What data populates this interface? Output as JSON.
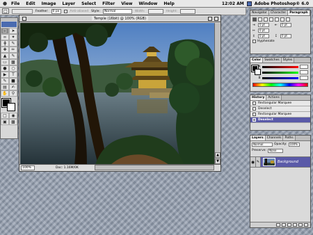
{
  "menubar": {
    "items": [
      "File",
      "Edit",
      "Image",
      "Layer",
      "Select",
      "Filter",
      "View",
      "Window",
      "Help"
    ],
    "clock": "12:02 AM",
    "app_name": "Adobe Photoshop® 6.0"
  },
  "options_bar": {
    "feather_label": "Feather:",
    "feather_value": "0 px",
    "antialiased_label": "Anti-aliased",
    "style_label": "Style:",
    "style_value": "Normal",
    "width_label": "Width:",
    "height_label": "Height:"
  },
  "document": {
    "title": "Temple (16bit) @ 100% (RGB)",
    "zoom": "100%",
    "doc_size": "Doc: 1.16M/0K"
  },
  "paragraph_palette": {
    "tabs": [
      "Navigator",
      "Character",
      "Paragraph"
    ],
    "fields": [
      "0 pt",
      "0 pt",
      "0 pt",
      "0 pt",
      "0 pt"
    ],
    "hyphenate_label": "Hyphenate"
  },
  "color_palette": {
    "tabs": [
      "Color",
      "Swatches",
      "Styles"
    ],
    "channels": [
      "R",
      "G",
      "B"
    ]
  },
  "history_palette": {
    "tabs": [
      "History",
      "Actions"
    ],
    "items": [
      "Rectangular Marquee",
      "Deselect",
      "Rectangular Marquee",
      "Deselect"
    ],
    "selected_index": 3
  },
  "layers_palette": {
    "tabs": [
      "Layers",
      "Channels",
      "Paths"
    ],
    "blend_mode": "Normal",
    "opacity_label": "Opacity:",
    "opacity": "100%",
    "preserve_label": "Preserve:",
    "lock_value": "None",
    "layer_name": "Background",
    "selected_color": "#5a5aa8"
  }
}
